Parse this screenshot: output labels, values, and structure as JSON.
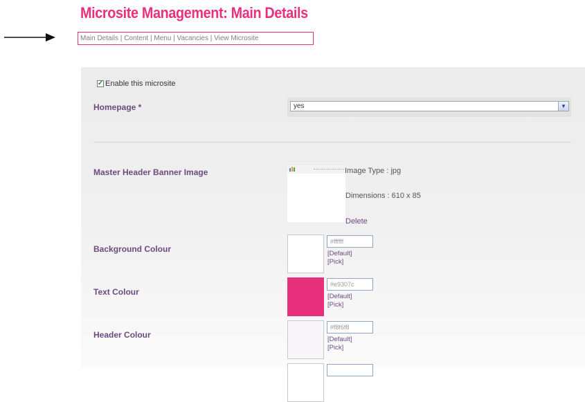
{
  "page": {
    "title": "Microsite Management: Main Details"
  },
  "nav": {
    "items": [
      {
        "label": "Main Details"
      },
      {
        "label": "Content"
      },
      {
        "label": "Menu"
      },
      {
        "label": "Vacancies"
      },
      {
        "label": "View Microsite"
      }
    ],
    "separator": " | "
  },
  "form": {
    "enable_label": "Enable this microsite",
    "enable_checked": true,
    "homepage": {
      "label": "Homepage *",
      "value": "yes"
    },
    "banner": {
      "label": "Master Header Banner Image",
      "image_type": "Image Type : jpg",
      "dimensions": "Dimensions : 610 x 85",
      "delete_label": "Delete"
    },
    "colours": [
      {
        "label": "Background Colour",
        "value": "#ffffff",
        "swatch": "#ffffff",
        "default_label": "[Default]",
        "pick_label": "[Pick]"
      },
      {
        "label": "Text Colour",
        "value": "#e9307c",
        "swatch": "#e8307c",
        "default_label": "[Default]",
        "pick_label": "[Pick]"
      },
      {
        "label": "Header Colour",
        "value": "#f8f6f8",
        "swatch": "#f8f6f8",
        "default_label": "[Default]",
        "pick_label": "[Pick]"
      }
    ]
  },
  "theme": {
    "accent": "#e8307c",
    "label_color": "#6b4a7e"
  }
}
